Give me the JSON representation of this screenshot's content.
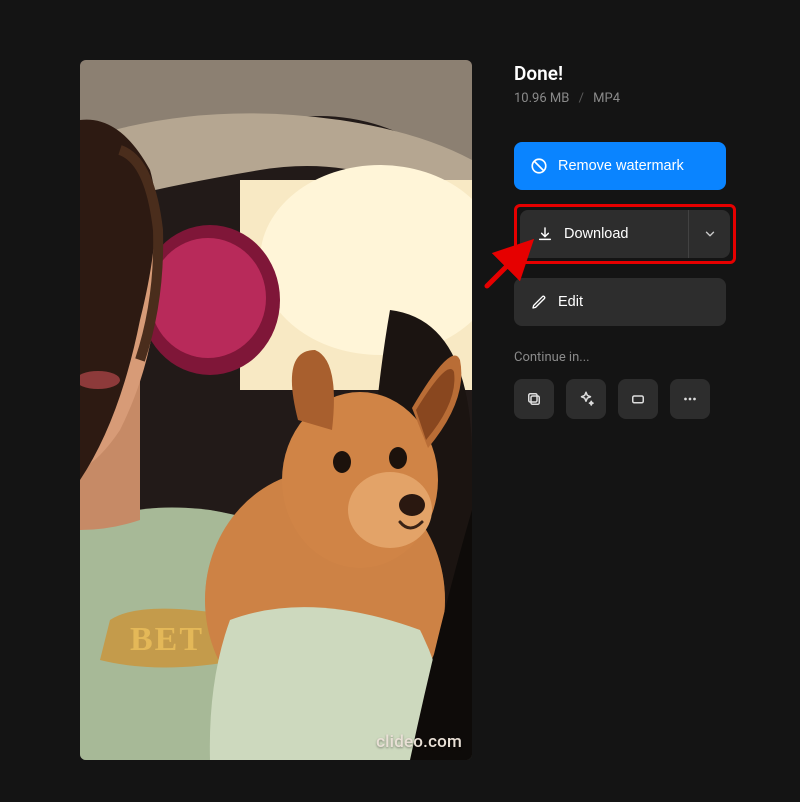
{
  "title": "Done!",
  "file": {
    "size": "10.96 MB",
    "format": "MP4"
  },
  "buttons": {
    "remove_watermark": "Remove watermark",
    "download": "Download",
    "edit": "Edit"
  },
  "continue_label": "Continue in...",
  "watermark": "clideo.com",
  "icons": {
    "remove": "prohibit-icon",
    "download": "download-icon",
    "chevron": "chevron-down-icon",
    "edit": "pencil-icon",
    "tool1": "copy-icon",
    "tool2": "sparkle-icon",
    "tool3": "crop-icon",
    "tool4": "more-icon"
  }
}
